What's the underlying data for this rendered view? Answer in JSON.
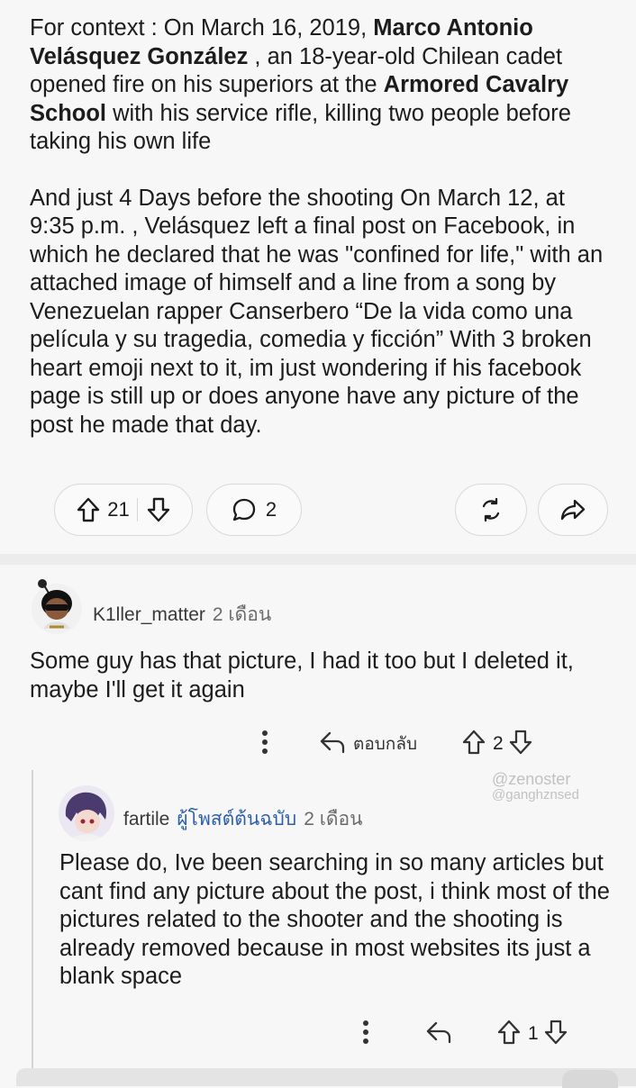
{
  "post": {
    "p1_a": "For context : On March 16, 2019, ",
    "p1_b": "Marco Antonio Velásquez González",
    "p1_c": " , an 18-year-old Chilean cadet opened fire on his superiors at the ",
    "p1_d": "Armored Cavalry School",
    "p1_e": " with his service rifle, killing two people before taking his own life",
    "p2": "And just 4 Days before the shooting On March 12, at 9:35 p.m. , Velásquez left a final post on Facebook, in which he declared that he was \"confined for life,\" with an attached image of himself and a line from a song by Venezuelan rapper Canserbero “De la vida como una película y su tragedia, comedia y ficción” With 3 broken heart emoji next to it, im just wondering if his facebook page is still up or does anyone have any picture of the post he made that day."
  },
  "post_actions": {
    "upvotes": "21",
    "comments": "2"
  },
  "comments": [
    {
      "author": "K1ller_matter",
      "time": "2 เดือน",
      "text": "Some guy has that picture, I had it too but I deleted it, maybe I'll get it again",
      "reply_label": "ตอบกลับ",
      "votes": "2"
    },
    {
      "author": "fartile",
      "flair": "ผู้โพสต์ต้นฉบับ",
      "time": "2 เดือน",
      "text": "Please do, Ive been searching in so many articles but cant find any picture about the post, i think most of the pictures related to the shooter and the shooting is already removed because in most websites its just a blank space",
      "votes": "1"
    }
  ],
  "watermark": {
    "line1": "@zenoster",
    "line2": "@ganghznsed"
  },
  "colors": {
    "background": "#f7f7f7",
    "text": "#1c1c1c",
    "flair": "#2b5fa8",
    "divider": "#ececec"
  }
}
